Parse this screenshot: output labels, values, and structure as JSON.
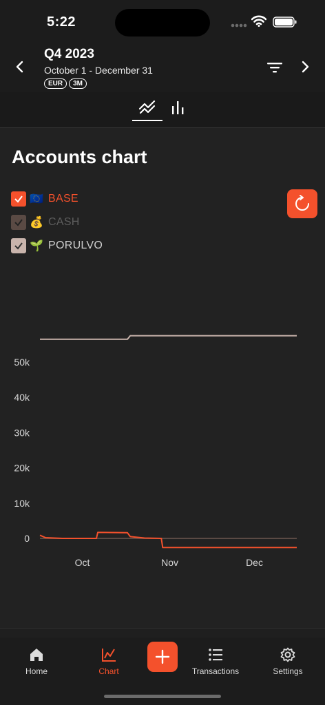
{
  "status_bar": {
    "time": "5:22"
  },
  "header": {
    "title": "Q4 2023",
    "date_range": "October 1 - December 31",
    "chips": [
      "EUR",
      "3M"
    ]
  },
  "view_tabs": {
    "active": "line",
    "icons": [
      "line-chart-icon",
      "bar-chart-icon"
    ]
  },
  "page_title": "Accounts chart",
  "legend": [
    {
      "emoji": "🇪🇺",
      "label": "BASE",
      "checked": true,
      "color": "#f4512c",
      "text_color": "#f4512c"
    },
    {
      "emoji": "💰",
      "label": "CASH",
      "checked": true,
      "color": "#5a4a44",
      "text_color": "#5e5e5e"
    },
    {
      "emoji": "🌱",
      "label": "PORULVO",
      "checked": true,
      "color": "#c9b4ac",
      "text_color": "#cfcfcf"
    }
  ],
  "chart_data": {
    "type": "line",
    "y_ticks": [
      "0",
      "10k",
      "20k",
      "30k",
      "40k",
      "50k"
    ],
    "x_ticks": [
      "Oct",
      "Nov",
      "Dec"
    ],
    "ylim": [
      -3000,
      60000
    ],
    "xlim_days": [
      0,
      91
    ],
    "series": [
      {
        "name": "PORULVO",
        "color": "#c9b4ac",
        "points": [
          [
            0,
            56500
          ],
          [
            31,
            56500
          ],
          [
            32,
            57500
          ],
          [
            91,
            57500
          ]
        ]
      },
      {
        "name": "CASH",
        "color": "#5a4a44",
        "points": [
          [
            0,
            0
          ],
          [
            91,
            0
          ]
        ]
      },
      {
        "name": "BASE",
        "color": "#f4512c",
        "points": [
          [
            0,
            900
          ],
          [
            2,
            200
          ],
          [
            8,
            0
          ],
          [
            20,
            0
          ],
          [
            20.5,
            1700
          ],
          [
            31,
            1600
          ],
          [
            32,
            500
          ],
          [
            37,
            100
          ],
          [
            43,
            0
          ],
          [
            43.5,
            -2600
          ],
          [
            91,
            -2600
          ]
        ]
      }
    ]
  },
  "nav": {
    "home": "Home",
    "chart": "Chart",
    "transactions": "Transactions",
    "settings": "Settings",
    "active": "chart"
  }
}
